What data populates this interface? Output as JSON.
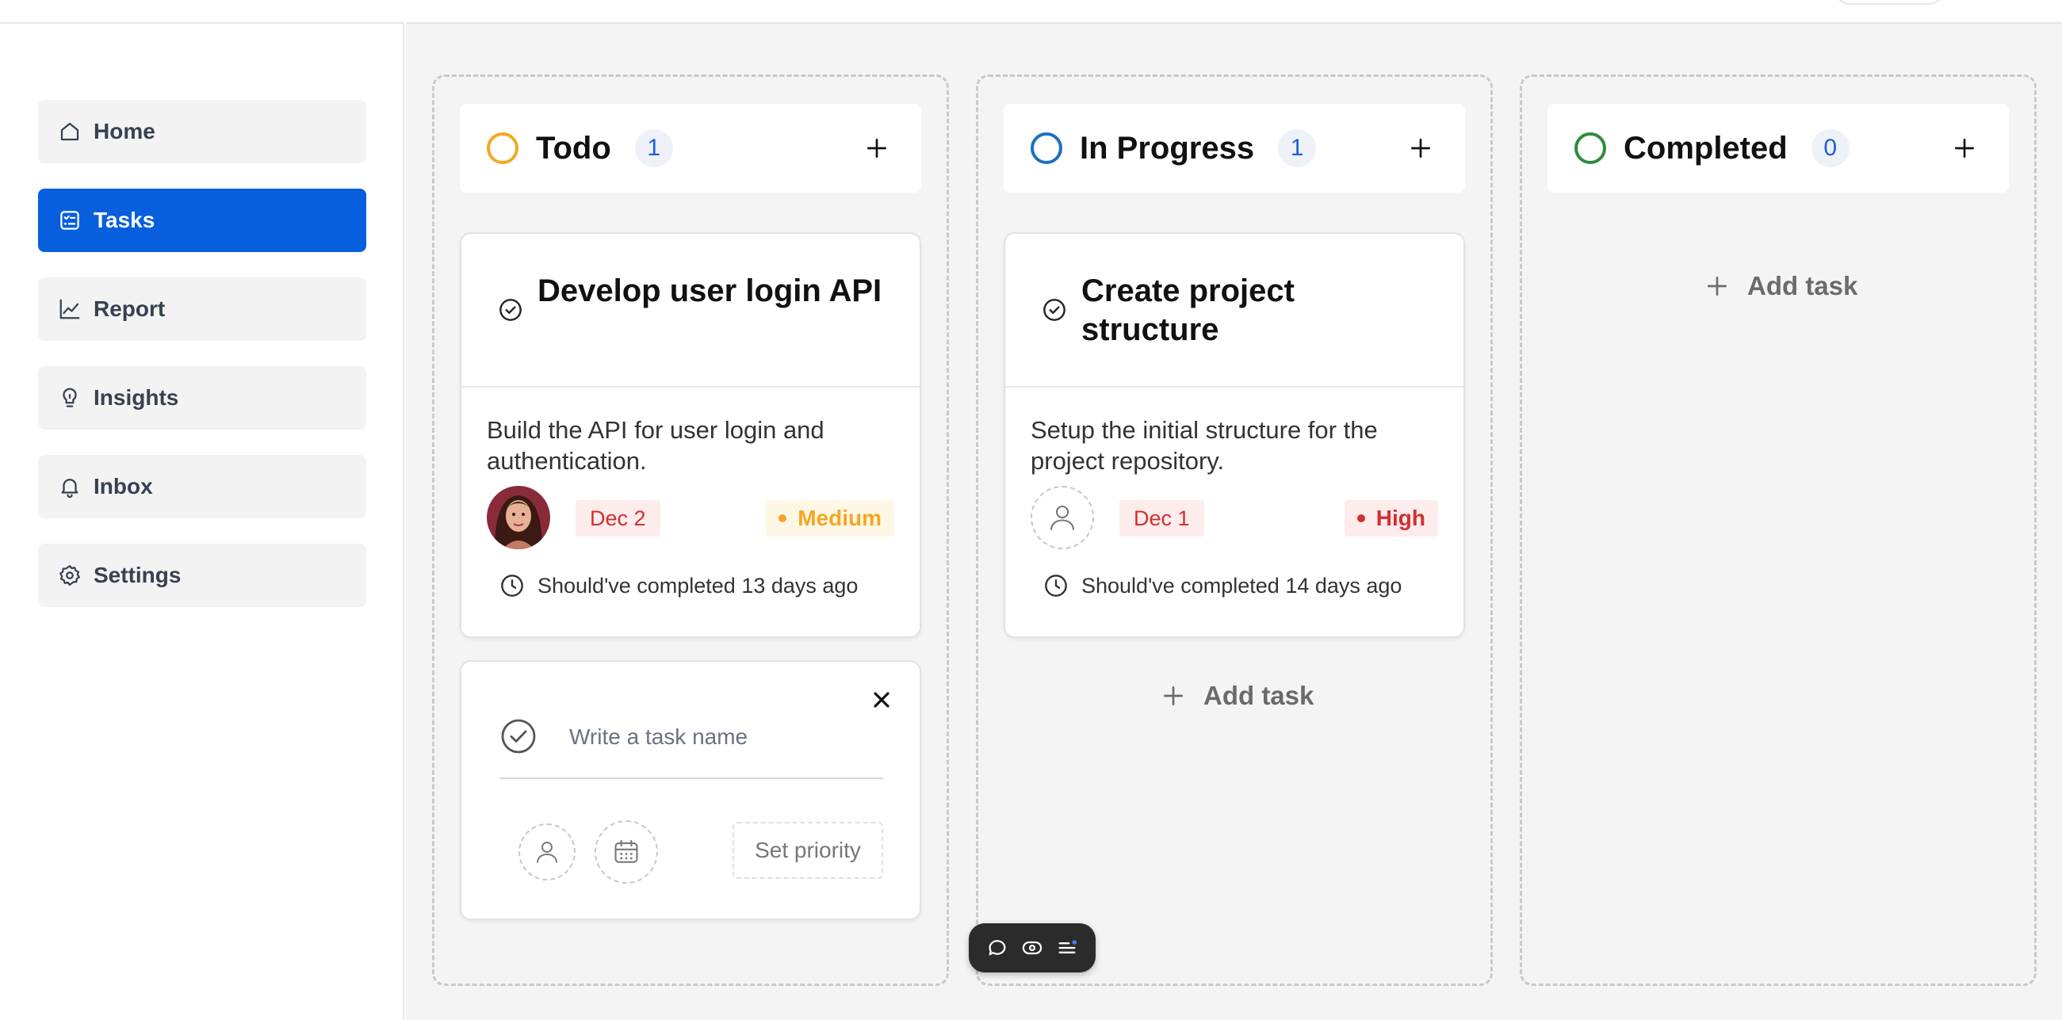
{
  "sidebar": {
    "items": [
      {
        "label": "Home",
        "icon": "home-icon"
      },
      {
        "label": "Tasks",
        "icon": "tasks-icon",
        "active": true
      },
      {
        "label": "Report",
        "icon": "chart-icon"
      },
      {
        "label": "Insights",
        "icon": "lightbulb-icon"
      },
      {
        "label": "Inbox",
        "icon": "bell-icon"
      },
      {
        "label": "Settings",
        "icon": "gear-icon"
      }
    ],
    "active_color": "#075fde"
  },
  "board": {
    "columns": [
      {
        "title": "Todo",
        "count": "1",
        "status_color": "#f5a623",
        "cards": [
          {
            "title": "Develop user login API",
            "description": "Build the API for user login and authentication.",
            "assignee": "avatar-photo",
            "date": "Dec 2",
            "priority": "Medium",
            "priority_color": "#f5a623",
            "overdue": "Should've completed 13 days ago"
          }
        ],
        "new_task": {
          "placeholder": "Write a task name",
          "set_priority": "Set priority"
        }
      },
      {
        "title": "In Progress",
        "count": "1",
        "status_color": "#1a6fc4",
        "cards": [
          {
            "title": "Create project structure",
            "description": "Setup the initial structure for the project repository.",
            "assignee": "unassigned",
            "date": "Dec 1",
            "priority": "High",
            "priority_color": "#d32f2f",
            "overdue": "Should've completed 14 days ago"
          }
        ],
        "add_task": "Add task"
      },
      {
        "title": "Completed",
        "count": "0",
        "status_color": "#2e8b3e",
        "cards": [],
        "add_task": "Add task"
      }
    ]
  },
  "floating_toolbar": {
    "icons": [
      "comment-icon",
      "eye-icon",
      "list-icon"
    ]
  }
}
